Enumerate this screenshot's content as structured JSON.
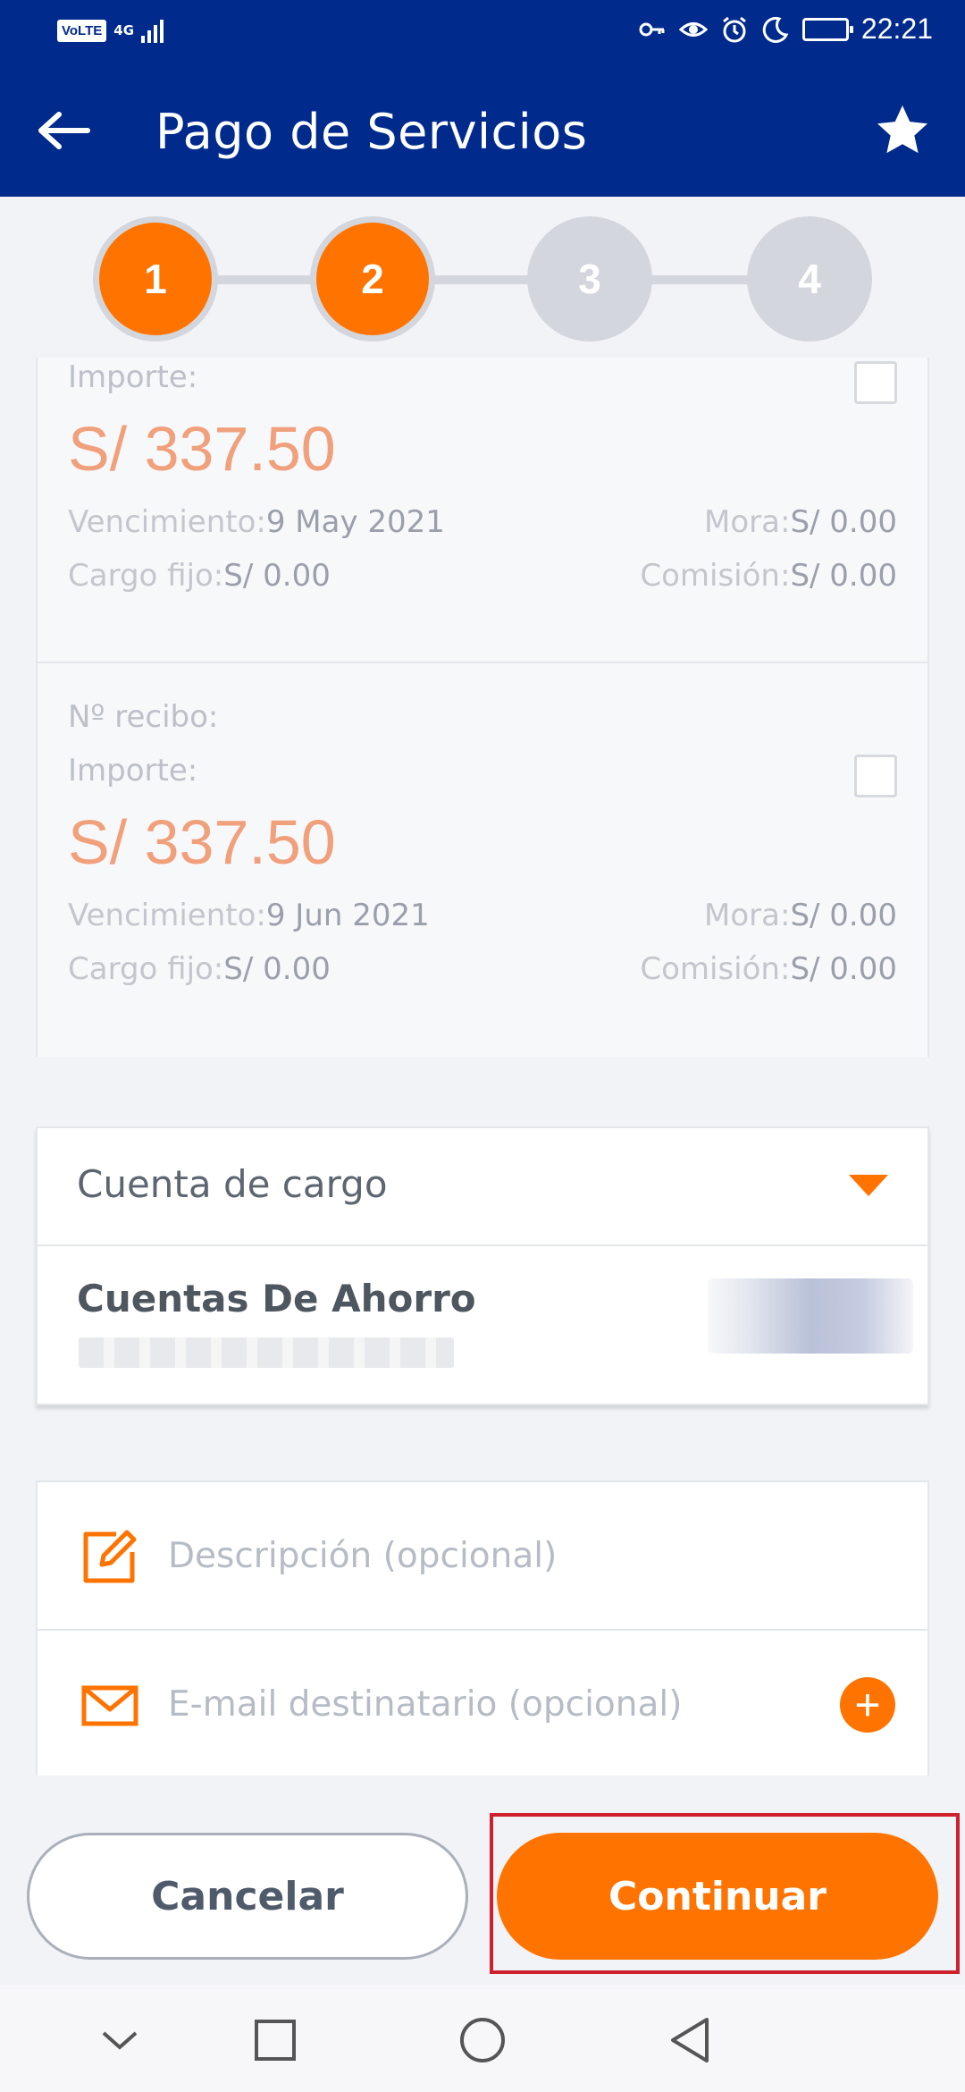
{
  "status_bar": {
    "volte": "VoLTE",
    "network": "4G",
    "time": "22:21"
  },
  "header": {
    "title": "Pago de Servicios",
    "back_icon": "arrow-left-icon",
    "favorite_icon": "star-icon"
  },
  "stepper": {
    "steps": [
      {
        "label": "1",
        "active": true
      },
      {
        "label": "2",
        "active": true
      },
      {
        "label": "3",
        "active": false
      },
      {
        "label": "4",
        "active": false
      }
    ]
  },
  "bills": [
    {
      "importe_label": "Importe:",
      "amount": "S/ 337.50",
      "vencimiento_label": "Vencimiento:",
      "vencimiento": "9 May 2021",
      "mora_label": "Mora:",
      "mora": "S/ 0.00",
      "cargo_label": "Cargo fijo:",
      "cargo": "S/ 0.00",
      "comision_label": "Comisión:",
      "comision": "S/ 0.00"
    },
    {
      "recibo_label": "Nº recibo:",
      "importe_label": "Importe:",
      "amount": "S/ 337.50",
      "vencimiento_label": "Vencimiento:",
      "vencimiento": "9 Jun 2021",
      "mora_label": "Mora:",
      "mora": "S/ 0.00",
      "cargo_label": "Cargo fijo:",
      "cargo": "S/ 0.00",
      "comision_label": "Comisión:",
      "comision": "S/ 0.00"
    }
  ],
  "account": {
    "title": "Cuenta de cargo",
    "account_name": "Cuentas De Ahorro"
  },
  "optional": {
    "description_placeholder": "Descripción (opcional)",
    "email_placeholder": "E-mail destinatario (opcional)",
    "add_symbol": "+"
  },
  "actions": {
    "cancel_label": "Cancelar",
    "continue_label": "Continuar"
  },
  "colors": {
    "header": "#002a8c",
    "accent": "#ff7300",
    "amount": "#f1a07c",
    "highlight": "#d0202e"
  }
}
